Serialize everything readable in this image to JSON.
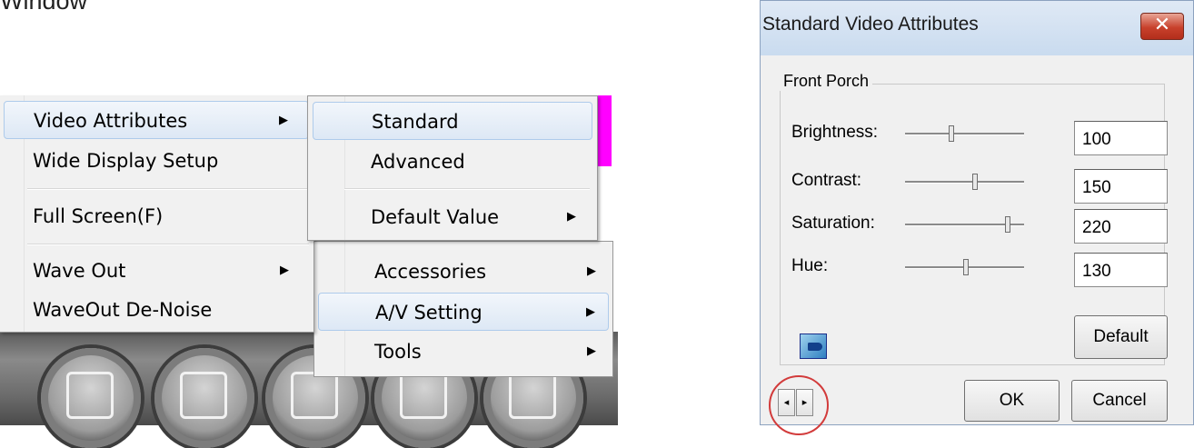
{
  "heading_fragment": "Window",
  "main_menu": {
    "items": [
      {
        "label": "Video Attributes",
        "has_submenu": true
      },
      {
        "label": "Wide Display Setup",
        "has_submenu": false
      },
      {
        "label": "Full Screen(F)",
        "has_submenu": false
      },
      {
        "label": "Wave Out",
        "has_submenu": true
      },
      {
        "label": "WaveOut De-Noise",
        "has_submenu": false
      }
    ],
    "arrow": "▶"
  },
  "video_attributes_menu": {
    "items": [
      {
        "label": "Standard",
        "highlighted": true
      },
      {
        "label": "Advanced",
        "highlighted": false
      },
      {
        "label": "Default Value",
        "has_submenu": true
      }
    ]
  },
  "tools_menu": {
    "items": [
      {
        "label": "Accessories",
        "has_submenu": true
      },
      {
        "label": "A/V Setting",
        "has_submenu": true,
        "highlighted": true
      },
      {
        "label": "Tools",
        "has_submenu": true
      }
    ]
  },
  "toolbar": {
    "icons": [
      "tape-deck-icon",
      "calendar-clock-icon",
      "tools-icon",
      "search-icon",
      "tv-icon"
    ]
  },
  "dialog": {
    "title": "Standard Video Attributes",
    "close_glyph": "✕",
    "group_label": "Front Porch",
    "rows": [
      {
        "label": "Brightness:",
        "value": "100",
        "slider_fraction": 0.39
      },
      {
        "label": "Contrast:",
        "value": "150",
        "slider_fraction": 0.59
      },
      {
        "label": "Saturation:",
        "value": "220",
        "slider_fraction": 0.86
      },
      {
        "label": "Hue:",
        "value": "130",
        "slider_fraction": 0.51
      }
    ],
    "default_button": "Default",
    "ok_button": "OK",
    "cancel_button": "Cancel",
    "spin_left": "◂",
    "spin_right": "▸"
  },
  "colors": {
    "accent_magenta": "#ff00ff",
    "close_button_red": "#c8412c",
    "annotation_circle": "#d23b3b",
    "menu_highlight": "#dde8f5"
  }
}
